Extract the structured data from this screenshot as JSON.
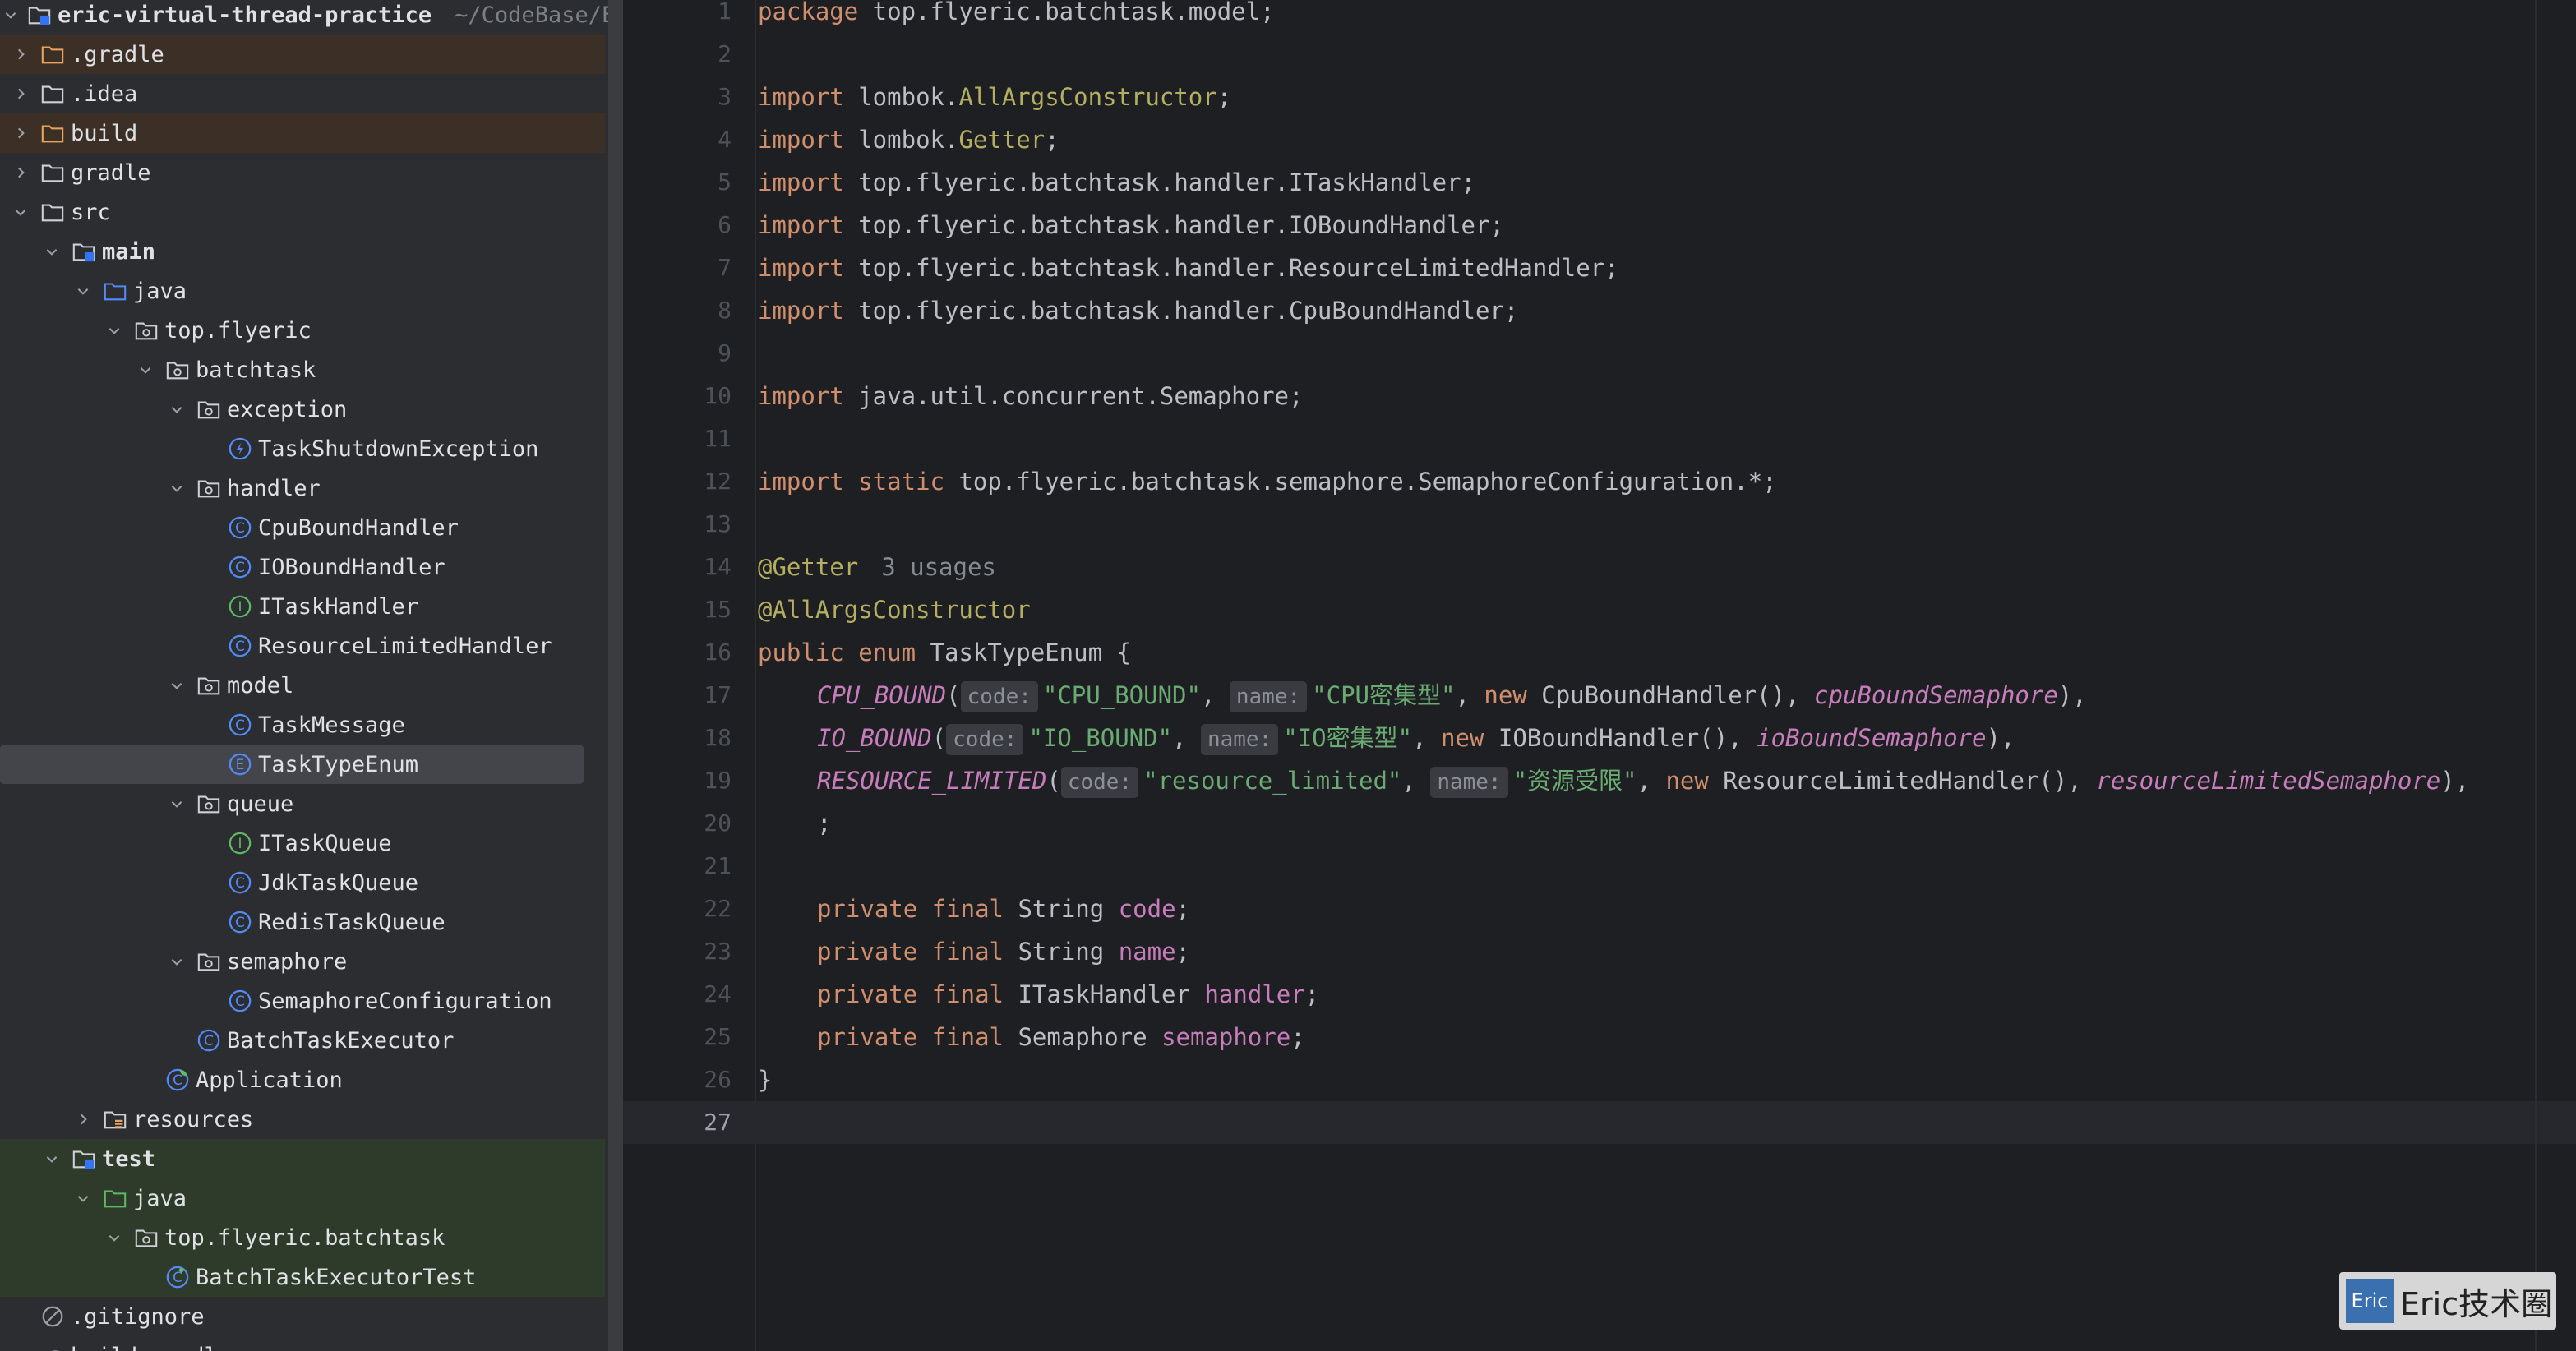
{
  "project": {
    "name": "eric-virtual-thread-practice",
    "path": "~/CodeBase/E"
  },
  "tree": [
    {
      "label": ".gradle",
      "icon": "folder-icon"
    },
    {
      "label": ".idea",
      "icon": "folder-icon"
    },
    {
      "label": "build",
      "icon": "folder-icon"
    },
    {
      "label": "gradle",
      "icon": "folder-icon"
    },
    {
      "label": "src",
      "icon": "folder-icon"
    },
    {
      "label": "main",
      "icon": "module-folder-icon"
    },
    {
      "label": "java",
      "icon": "source-folder-icon"
    },
    {
      "label": "top.flyeric",
      "icon": "package-icon"
    },
    {
      "label": "batchtask",
      "icon": "package-icon"
    },
    {
      "label": "exception",
      "icon": "package-icon"
    },
    {
      "label": "TaskShutdownException",
      "icon": "exception-class-icon"
    },
    {
      "label": "handler",
      "icon": "package-icon"
    },
    {
      "label": "CpuBoundHandler",
      "icon": "class-icon"
    },
    {
      "label": "IOBoundHandler",
      "icon": "class-icon"
    },
    {
      "label": "ITaskHandler",
      "icon": "interface-icon"
    },
    {
      "label": "ResourceLimitedHandler",
      "icon": "class-icon"
    },
    {
      "label": "model",
      "icon": "package-icon"
    },
    {
      "label": "TaskMessage",
      "icon": "class-icon"
    },
    {
      "label": "TaskTypeEnum",
      "icon": "enum-icon"
    },
    {
      "label": "queue",
      "icon": "package-icon"
    },
    {
      "label": "ITaskQueue",
      "icon": "interface-icon"
    },
    {
      "label": "JdkTaskQueue",
      "icon": "class-icon"
    },
    {
      "label": "RedisTaskQueue",
      "icon": "class-icon"
    },
    {
      "label": "semaphore",
      "icon": "package-icon"
    },
    {
      "label": "SemaphoreConfiguration",
      "icon": "class-icon"
    },
    {
      "label": "BatchTaskExecutor",
      "icon": "class-icon"
    },
    {
      "label": "Application",
      "icon": "spring-class-icon"
    },
    {
      "label": "resources",
      "icon": "resources-folder-icon"
    },
    {
      "label": "test",
      "icon": "module-folder-icon"
    },
    {
      "label": "java",
      "icon": "test-folder-icon"
    },
    {
      "label": "top.flyeric.batchtask",
      "icon": "package-icon"
    },
    {
      "label": "BatchTaskExecutorTest",
      "icon": "test-class-icon"
    },
    {
      "label": ".gitignore",
      "icon": "ignore-file-icon"
    },
    {
      "label": "build.gradle",
      "icon": "gradle-file-icon"
    }
  ],
  "editor": {
    "line_numbers": [
      "1",
      "2",
      "3",
      "4",
      "5",
      "6",
      "7",
      "8",
      "9",
      "10",
      "11",
      "12",
      "13",
      "14",
      "15",
      "16",
      "17",
      "18",
      "19",
      "20",
      "21",
      "22",
      "23",
      "24",
      "25",
      "26",
      "27"
    ],
    "current_line": "27",
    "code": {
      "l1": [
        "package",
        " top.flyeric.batchtask.model;"
      ],
      "l3": [
        "import",
        " lombok.",
        "AllArgsConstructor",
        ";"
      ],
      "l4": [
        "import",
        " lombok.",
        "Getter",
        ";"
      ],
      "l5": [
        "import",
        " top.flyeric.batchtask.handler.ITaskHandler;"
      ],
      "l6": [
        "import",
        " top.flyeric.batchtask.handler.IOBoundHandler;"
      ],
      "l7": [
        "import",
        " top.flyeric.batchtask.handler.ResourceLimitedHandler;"
      ],
      "l8": [
        "import",
        " top.flyeric.batchtask.handler.CpuBoundHandler;"
      ],
      "l10": [
        "import",
        " java.util.concurrent.Semaphore;"
      ],
      "l12": [
        "import",
        " ",
        "static",
        " top.flyeric.batchtask.semaphore.SemaphoreConfiguration.*;"
      ],
      "l14": [
        "@Getter",
        "3 usages"
      ],
      "l15": [
        "@AllArgsConstructor"
      ],
      "l16": [
        "public",
        " ",
        "enum",
        " TaskTypeEnum {"
      ],
      "l17": [
        "CPU_BOUND",
        "(",
        "code:",
        "\"CPU_BOUND\"",
        ", ",
        "name:",
        "\"CPU密集型\"",
        ", ",
        "new",
        " CpuBoundHandler(), ",
        "cpuBoundSemaphore",
        "),"
      ],
      "l18": [
        "IO_BOUND",
        "(",
        "code:",
        "\"IO_BOUND\"",
        ", ",
        "name:",
        "\"IO密集型\"",
        ", ",
        "new",
        " IOBoundHandler(), ",
        "ioBoundSemaphore",
        "),"
      ],
      "l19": [
        "RESOURCE_LIMITED",
        "(",
        "code:",
        "\"resource_limited\"",
        ", ",
        "name:",
        "\"资源受限\"",
        ", ",
        "new",
        " ResourceLimitedHandler(), ",
        "resourceLimitedSemaphore",
        "),"
      ],
      "l20": [
        ";"
      ],
      "l22": [
        "private",
        " ",
        "final",
        " String ",
        "code",
        ";"
      ],
      "l23": [
        "private",
        " ",
        "final",
        " String ",
        "name",
        ";"
      ],
      "l24": [
        "private",
        " ",
        "final",
        " ITaskHandler ",
        "handler",
        ";"
      ],
      "l25": [
        "private",
        " ",
        "final",
        " Semaphore ",
        "semaphore",
        ";"
      ],
      "l26": [
        "}"
      ]
    }
  },
  "watermark": {
    "logo": "Eric",
    "text": "Eric技术圈"
  },
  "colors": {
    "keyword": "#cf8e6d",
    "annotation": "#b3ae60",
    "string": "#6aab73",
    "constant": "#c77dbb",
    "plain": "#bcbec4",
    "background": "#1e1f22",
    "sidebar": "#2b2d30"
  }
}
